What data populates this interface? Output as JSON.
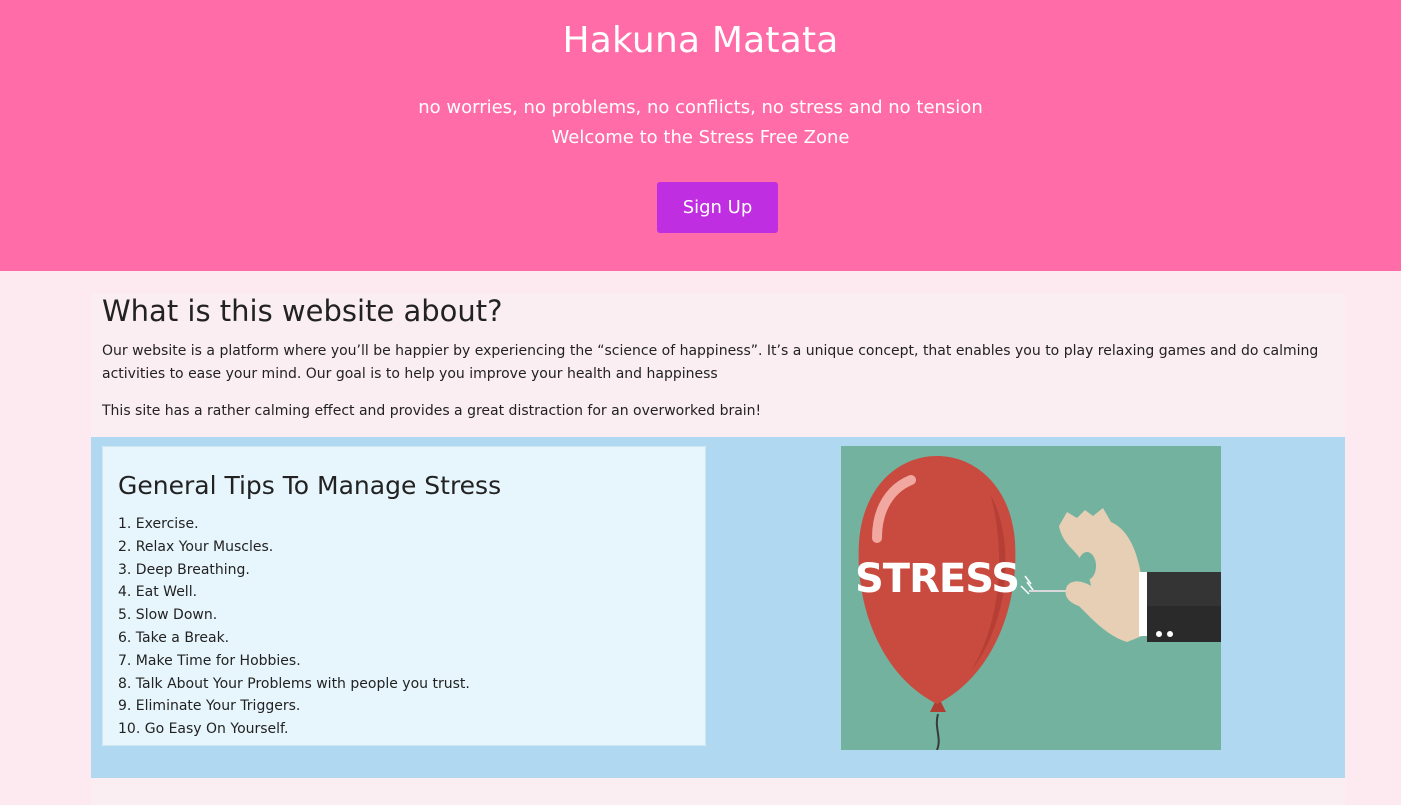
{
  "hero": {
    "title": "Hakuna Matata",
    "tagline": "no worries, no problems, no conflicts, no stress and no tension",
    "welcome": "Welcome to the Stress Free Zone",
    "signup_label": "Sign Up"
  },
  "about": {
    "title": "What is this website about?",
    "paragraph1": "Our website is a platform where you’ll be happier by experiencing the “science of happiness”. It’s a unique concept, that enables you to play relaxing games and do calming activities to ease your mind. Our goal is to help you improve your health and happiness",
    "paragraph2": "This site has a rather calming effect and provides a great distraction for an overworked brain!"
  },
  "tips": {
    "title": "General Tips To Manage Stress",
    "items": [
      "1. Exercise.",
      "2. Relax Your Muscles.",
      "3. Deep Breathing.",
      "4. Eat Well.",
      "5. Slow Down.",
      "6. Take a Break.",
      "7. Make Time for Hobbies.",
      "8. Talk About Your Problems with people you trust.",
      "9. Eliminate Your Triggers.",
      "10. Go Easy On Yourself."
    ]
  },
  "image": {
    "balloon_text": "STRESS",
    "icon": "stress-balloon-pin-illustration"
  },
  "colors": {
    "hero_bg": "#ff6ca8",
    "button_bg": "#c02ee2",
    "page_bg": "#fde9f0",
    "tips_section_bg": "#b0d9f1",
    "tips_box_bg": "#e7f6fd",
    "image_bg": "#72b29f",
    "balloon": "#c94a3e"
  }
}
